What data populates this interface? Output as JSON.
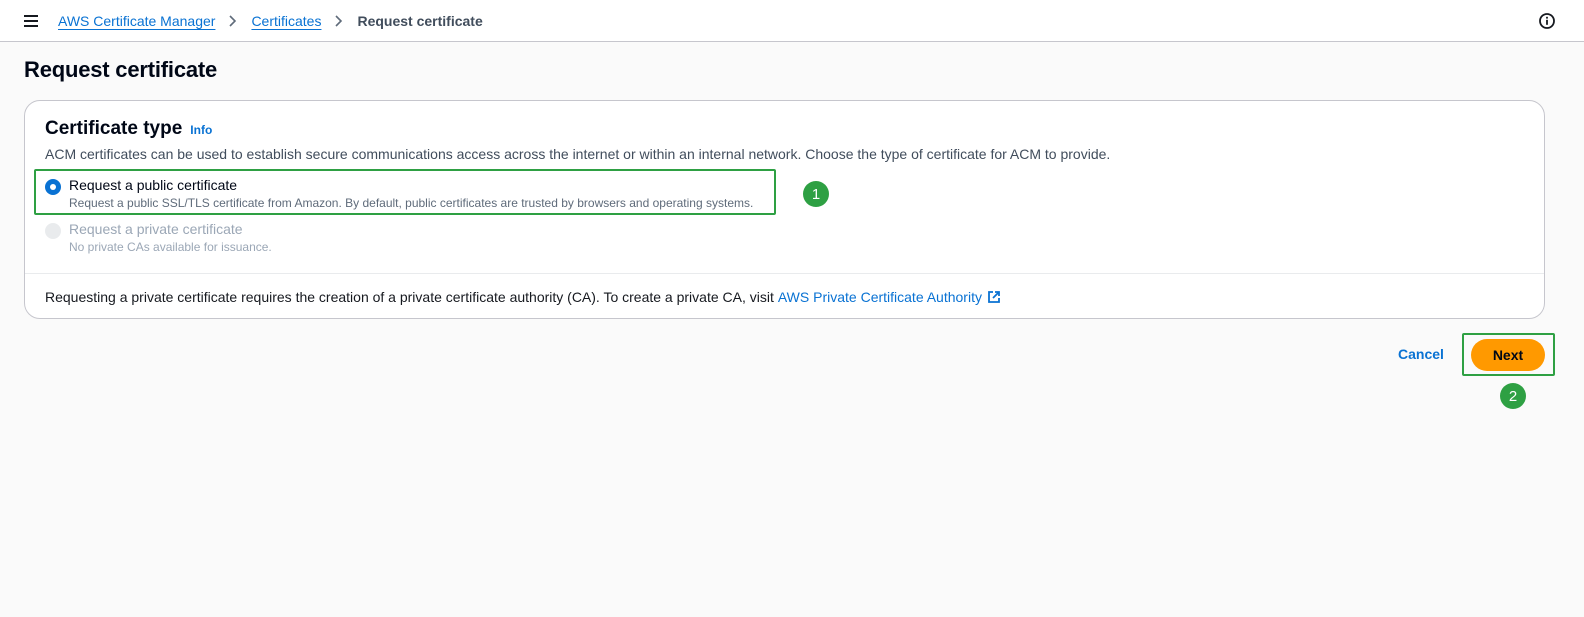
{
  "breadcrumb": {
    "items": [
      {
        "label": "AWS Certificate Manager"
      },
      {
        "label": "Certificates"
      }
    ],
    "current": "Request certificate"
  },
  "page": {
    "title": "Request certificate"
  },
  "certificate_type": {
    "title": "Certificate type",
    "info_label": "Info",
    "description": "ACM certificates can be used to establish secure communications access across the internet or within an internal network. Choose the type of certificate for ACM to provide.",
    "options": [
      {
        "label": "Request a public certificate",
        "sublabel": "Request a public SSL/TLS certificate from Amazon. By default, public certificates are trusted by browsers and operating systems.",
        "selected": true,
        "disabled": false
      },
      {
        "label": "Request a private certificate",
        "sublabel": "No private CAs available for issuance.",
        "selected": false,
        "disabled": true
      }
    ],
    "footer_text": "Requesting a private certificate requires the creation of a private certificate authority (CA). To create a private CA, visit",
    "footer_link": "AWS Private Certificate Authority"
  },
  "actions": {
    "cancel_label": "Cancel",
    "next_label": "Next"
  },
  "annotations": {
    "step1": "1",
    "step2": "2"
  },
  "colors": {
    "link": "#0972d3",
    "primary_button": "#ff9900",
    "annotation": "#2ea043"
  }
}
